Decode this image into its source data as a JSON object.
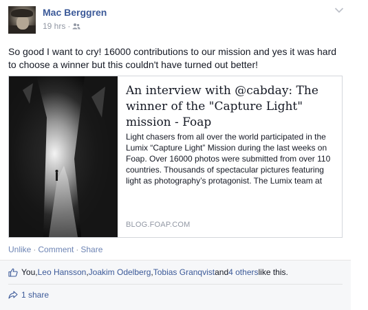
{
  "post": {
    "author": "Mac Berggren",
    "time": "19 hrs",
    "separator": "·",
    "message": "So good I want to cry! 16000 contributions to our mission and yes it was hard to choose a winner but this couldn't have turned out better!"
  },
  "link_card": {
    "title": "An interview with @cabday: The winner of the \"Capture Light\" mission - Foap",
    "description": "Light chasers from all over the world participated in the Lumix “Capture Light” Mission during the last weeks on Foap. Over 16000 photos were submitted from over 110 countries. Thousands of spectacular pictures featuring light as photography’s protagonist. The Lumix team at",
    "domain": "BLOG.FOAP.COM"
  },
  "actions": {
    "unlike": "Unlike",
    "comment": "Comment",
    "share": "Share",
    "sep": "·"
  },
  "likes": {
    "you": "You, ",
    "leo": "Leo Hansson",
    "comma1": ", ",
    "joakim": "Joakim Odelberg",
    "comma2": ", ",
    "tobias": "Tobias Granqvist",
    "and": " and ",
    "others": "4 others",
    "tail": " like this."
  },
  "shares": {
    "label": "1 share"
  },
  "icons": {
    "audience": "friends-icon",
    "menu": "chevron-down-icon",
    "like": "thumbs-up-icon",
    "share": "share-arrow-icon"
  },
  "colors": {
    "link": "#3b5998",
    "action_link": "#6d84b4",
    "muted": "#9197a3",
    "feedback_bg": "#f6f7f9"
  }
}
